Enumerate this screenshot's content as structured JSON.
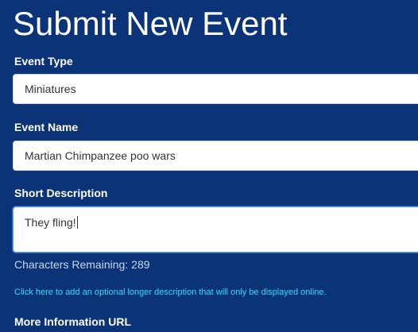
{
  "page": {
    "title": "Submit New Event"
  },
  "form": {
    "event_type": {
      "label": "Event Type",
      "selected": "Miniatures"
    },
    "event_name": {
      "label": "Event Name",
      "value": "Martian Chimpanzee poo wars"
    },
    "short_description": {
      "label": "Short Description",
      "value": "They fling!"
    },
    "characters_remaining": {
      "label": "Characters Remaining:",
      "count": "289"
    },
    "longer_description_link": "Click here to add an optional longer description that will only be displayed online.",
    "more_info_url": {
      "label": "More Information URL"
    }
  }
}
